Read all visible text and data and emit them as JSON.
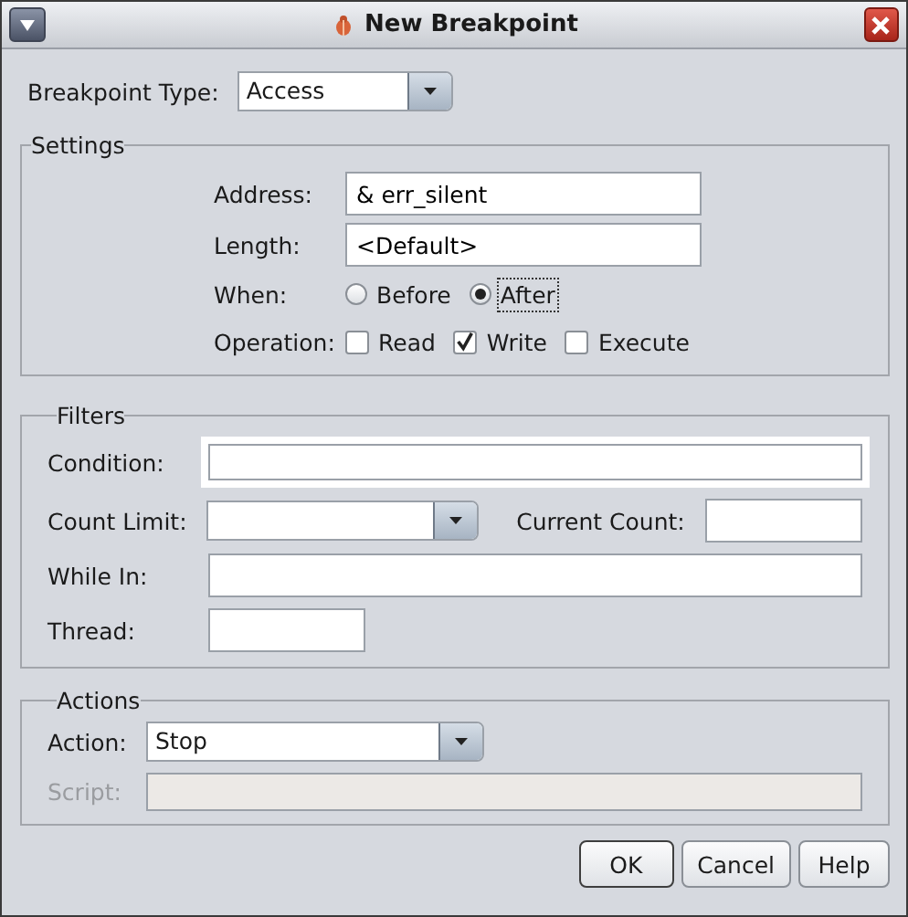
{
  "window": {
    "title": "New Breakpoint"
  },
  "breakpoint_type": {
    "label": "Breakpoint Type:",
    "value": "Access"
  },
  "settings": {
    "title": "Settings",
    "address": {
      "label": "Address:",
      "value": "& err_silent"
    },
    "length": {
      "label": "Length:",
      "value": "<Default>"
    },
    "when": {
      "label": "When:",
      "options": [
        {
          "label": "Before",
          "selected": false
        },
        {
          "label": "After",
          "selected": true
        }
      ]
    },
    "operation": {
      "label": "Operation:",
      "options": [
        {
          "label": "Read",
          "checked": false
        },
        {
          "label": "Write",
          "checked": true
        },
        {
          "label": "Execute",
          "checked": false
        }
      ]
    }
  },
  "filters": {
    "title": "Filters",
    "condition": {
      "label": "Condition:"
    },
    "count_limit": {
      "label": "Count Limit:"
    },
    "current_count": {
      "label": "Current Count:"
    },
    "while_in": {
      "label": "While In:"
    },
    "thread": {
      "label": "Thread:"
    }
  },
  "actions": {
    "title": "Actions",
    "action": {
      "label": "Action:",
      "value": "Stop"
    },
    "script": {
      "label": "Script:",
      "disabled": true
    }
  },
  "buttons": [
    {
      "label": "OK",
      "default": true
    },
    {
      "label": "Cancel",
      "default": false
    },
    {
      "label": "Help",
      "default": false
    }
  ]
}
